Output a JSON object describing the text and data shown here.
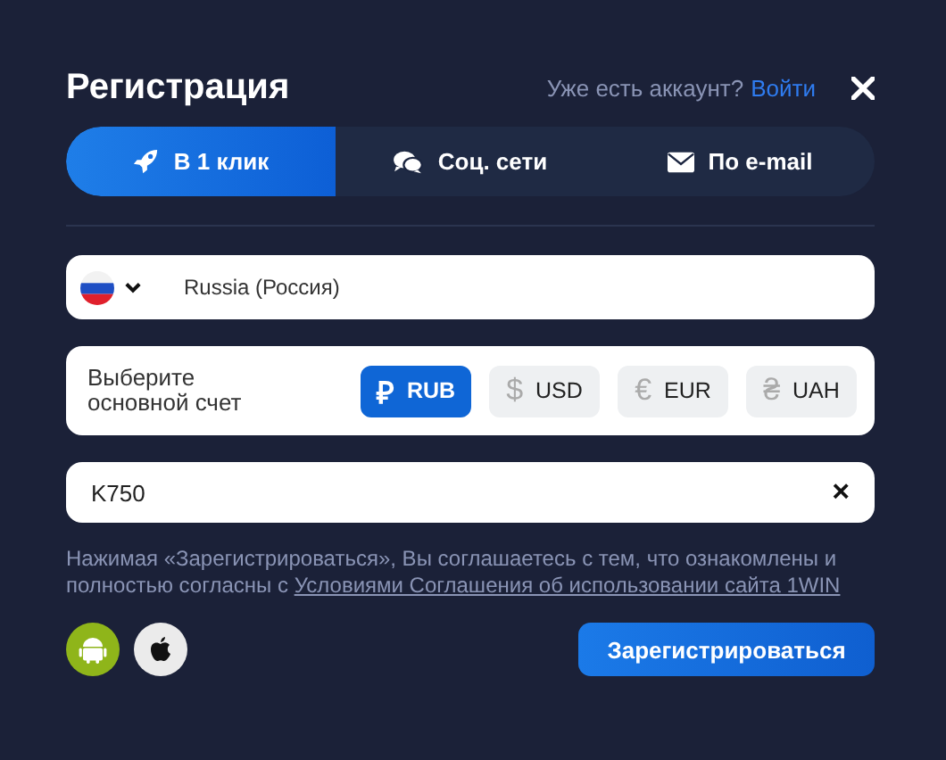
{
  "header": {
    "title": "Регистрация",
    "account_prompt": "Уже есть аккаунт?",
    "login_link": "Войти"
  },
  "tabs": [
    {
      "label": "В 1 клик",
      "kind": "rocket",
      "selected": true
    },
    {
      "label": "Соц. сети",
      "kind": "chat",
      "selected": false
    },
    {
      "label": "По e-mail",
      "kind": "mail",
      "selected": false
    }
  ],
  "country_field": {
    "value": "Russia (Россия)"
  },
  "currency": {
    "label": "Выберите основной счет",
    "options": [
      {
        "symbol": "₽",
        "code": "RUB",
        "selected": true
      },
      {
        "symbol": "$",
        "code": "USD",
        "selected": false
      },
      {
        "symbol": "€",
        "code": "EUR",
        "selected": false
      },
      {
        "symbol": "₴",
        "code": "UAH",
        "selected": false
      }
    ]
  },
  "promo_field": {
    "value": "K750",
    "clear": "×"
  },
  "terms": {
    "text": "Нажимая «Зарегистрироваться», Вы соглашаетесь с тем, что ознакомлены и полностью согласны с",
    "link": "Условиями Соглашения об использовании сайта 1WIN"
  },
  "apps": [
    {
      "kind": "android"
    },
    {
      "kind": "apple"
    }
  ],
  "submit": "Зарегистрироваться"
}
